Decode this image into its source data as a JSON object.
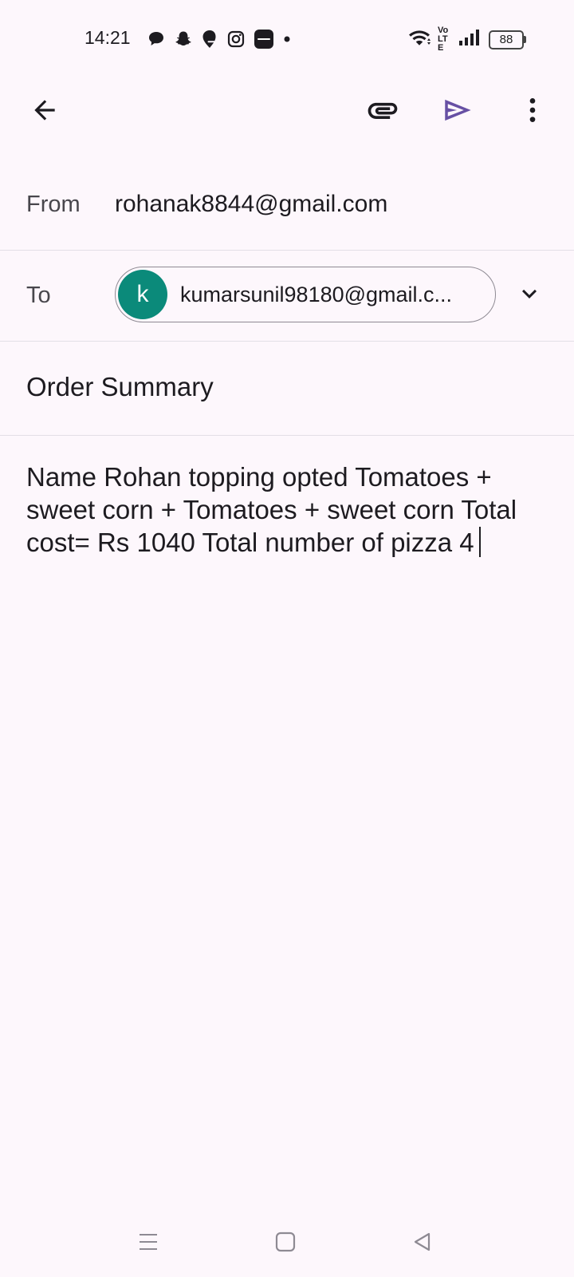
{
  "status_bar": {
    "time": "14:21",
    "notification_icons": [
      "chat-bubble-icon",
      "snapchat-icon",
      "swiggy-icon",
      "instagram-icon",
      "zomato-icon",
      "dot-icon"
    ],
    "network_label": "Vo LTE",
    "battery": "88"
  },
  "toolbar": {
    "icons": [
      "back-arrow-icon",
      "attachment-icon",
      "send-icon",
      "more-vert-icon"
    ],
    "accent_color": "#6750a4"
  },
  "compose": {
    "from_label": "From",
    "from_value": "rohanak8844@gmail.com",
    "to_label": "To",
    "to_chip": {
      "avatar_letter": "k",
      "avatar_color": "#0b8a7a",
      "email": "kumarsunil98180@gmail.c..."
    },
    "subject": "Order Summary",
    "body": "Name Rohan topping opted Tomatoes + sweet corn + Tomatoes + sweet corn Total cost= Rs 1040 Total number of pizza 4"
  },
  "nav_bar": {
    "icons": [
      "menu-lines-icon",
      "home-square-icon",
      "back-triangle-icon"
    ]
  }
}
